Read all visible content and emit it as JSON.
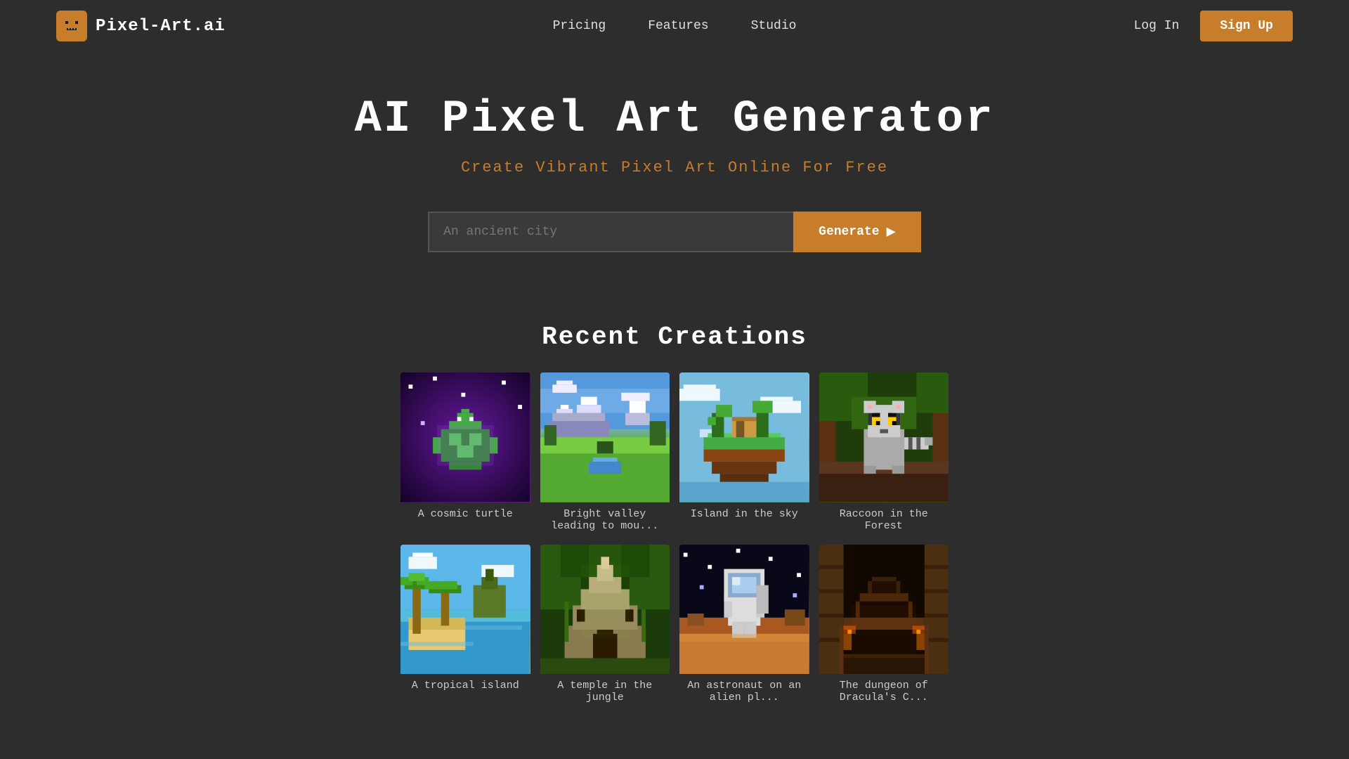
{
  "brand": {
    "name": "Pixel-Art.ai",
    "logo_emoji": "🎮"
  },
  "navbar": {
    "links": [
      {
        "id": "pricing",
        "label": "Pricing"
      },
      {
        "id": "features",
        "label": "Features"
      },
      {
        "id": "studio",
        "label": "Studio"
      }
    ],
    "login_label": "Log In",
    "signup_label": "Sign Up"
  },
  "hero": {
    "title": "AI Pixel Art Generator",
    "subtitle": "Create Vibrant Pixel Art Online For Free"
  },
  "search": {
    "placeholder": "An ancient city",
    "button_label": "Generate"
  },
  "recent": {
    "title": "Recent Creations",
    "items": [
      {
        "id": "cosmic-turtle",
        "label": "A cosmic turtle",
        "emoji": "🐢",
        "style": "cosmic"
      },
      {
        "id": "bright-valley",
        "label": "Bright valley leading to mou...",
        "emoji": "🏔️",
        "style": "valley"
      },
      {
        "id": "island-sky",
        "label": "Island in the sky",
        "emoji": "🏝️",
        "style": "island"
      },
      {
        "id": "raccoon-forest",
        "label": "Raccoon in the Forest",
        "emoji": "🦝",
        "style": "raccoon"
      },
      {
        "id": "tropical-island",
        "label": "A tropical island",
        "emoji": "🌴",
        "style": "tropical"
      },
      {
        "id": "temple-jungle",
        "label": "A temple in the jungle",
        "emoji": "🏛️",
        "style": "temple"
      },
      {
        "id": "astronaut-alien",
        "label": "An astronaut on an alien pl...",
        "emoji": "👨‍🚀",
        "style": "astronaut"
      },
      {
        "id": "dungeon-dracula",
        "label": "The dungeon of Dracula's C...",
        "emoji": "🏰",
        "style": "dungeon"
      }
    ]
  },
  "colors": {
    "accent": "#c87d2a",
    "bg": "#2d2d2d",
    "text_primary": "#ffffff",
    "text_secondary": "#cccccc",
    "text_muted": "#999999"
  }
}
